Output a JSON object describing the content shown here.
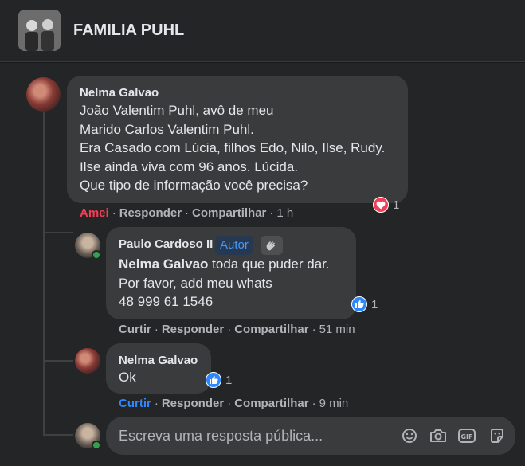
{
  "group": {
    "title": "FAMILIA PUHL"
  },
  "comments": [
    {
      "author": "Nelma Galvao",
      "lines": [
        "João Valentim Puhl, avô de meu",
        "Marido Carlos Valentim Puhl.",
        "Era Casado com Lúcia, filhos Edo, Nilo, Ilse, Rudy.",
        "Ilse ainda viva com 96 anos. Lúcida.",
        "Que tipo de informação você precisa?"
      ],
      "reaction_count": "1",
      "actions": {
        "react": "Amei",
        "reply": "Responder",
        "share": "Compartilhar",
        "time": "1 h"
      }
    }
  ],
  "replies": [
    {
      "author": "Paulo Cardoso II",
      "badge": "Autor",
      "mention": "Nelma Galvao",
      "mention_rest": " toda que puder dar.",
      "lines": [
        "Por favor, add meu whats",
        "48 999 61 1546"
      ],
      "reaction_count": "1",
      "actions": {
        "react": "Curtir",
        "reply": "Responder",
        "share": "Compartilhar",
        "time": "51 min"
      }
    },
    {
      "author": "Nelma Galvao",
      "text": "Ok",
      "reaction_count": "1",
      "actions": {
        "react": "Curtir",
        "reply": "Responder",
        "share": "Compartilhar",
        "time": "9 min"
      }
    }
  ],
  "composer": {
    "placeholder": "Escreva uma resposta pública..."
  },
  "icons": {
    "group_avatar": "group-photo",
    "love": "heart-icon",
    "like": "thumbs-up-icon",
    "wave": "waving-hand-icon",
    "emoji": "emoji-icon",
    "camera": "camera-icon",
    "gif": "gif-icon",
    "sticker": "sticker-icon"
  },
  "colors": {
    "background": "#18191a",
    "surface": "#242526",
    "bubble": "#3a3b3c",
    "love": "#f33e58",
    "like": "#2d88ff",
    "online": "#31a24c"
  }
}
